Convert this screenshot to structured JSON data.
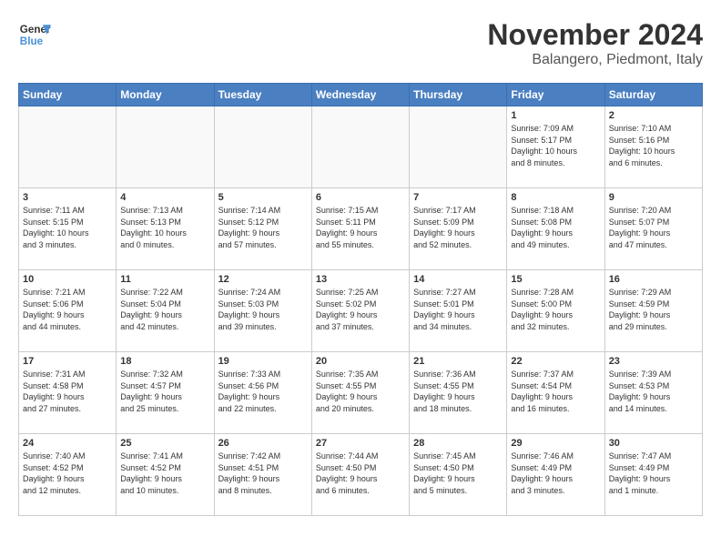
{
  "header": {
    "logo_line1": "General",
    "logo_line2": "Blue",
    "title": "November 2024",
    "subtitle": "Balangero, Piedmont, Italy"
  },
  "weekdays": [
    "Sunday",
    "Monday",
    "Tuesday",
    "Wednesday",
    "Thursday",
    "Friday",
    "Saturday"
  ],
  "weeks": [
    [
      {
        "day": "",
        "info": ""
      },
      {
        "day": "",
        "info": ""
      },
      {
        "day": "",
        "info": ""
      },
      {
        "day": "",
        "info": ""
      },
      {
        "day": "",
        "info": ""
      },
      {
        "day": "1",
        "info": "Sunrise: 7:09 AM\nSunset: 5:17 PM\nDaylight: 10 hours\nand 8 minutes."
      },
      {
        "day": "2",
        "info": "Sunrise: 7:10 AM\nSunset: 5:16 PM\nDaylight: 10 hours\nand 6 minutes."
      }
    ],
    [
      {
        "day": "3",
        "info": "Sunrise: 7:11 AM\nSunset: 5:15 PM\nDaylight: 10 hours\nand 3 minutes."
      },
      {
        "day": "4",
        "info": "Sunrise: 7:13 AM\nSunset: 5:13 PM\nDaylight: 10 hours\nand 0 minutes."
      },
      {
        "day": "5",
        "info": "Sunrise: 7:14 AM\nSunset: 5:12 PM\nDaylight: 9 hours\nand 57 minutes."
      },
      {
        "day": "6",
        "info": "Sunrise: 7:15 AM\nSunset: 5:11 PM\nDaylight: 9 hours\nand 55 minutes."
      },
      {
        "day": "7",
        "info": "Sunrise: 7:17 AM\nSunset: 5:09 PM\nDaylight: 9 hours\nand 52 minutes."
      },
      {
        "day": "8",
        "info": "Sunrise: 7:18 AM\nSunset: 5:08 PM\nDaylight: 9 hours\nand 49 minutes."
      },
      {
        "day": "9",
        "info": "Sunrise: 7:20 AM\nSunset: 5:07 PM\nDaylight: 9 hours\nand 47 minutes."
      }
    ],
    [
      {
        "day": "10",
        "info": "Sunrise: 7:21 AM\nSunset: 5:06 PM\nDaylight: 9 hours\nand 44 minutes."
      },
      {
        "day": "11",
        "info": "Sunrise: 7:22 AM\nSunset: 5:04 PM\nDaylight: 9 hours\nand 42 minutes."
      },
      {
        "day": "12",
        "info": "Sunrise: 7:24 AM\nSunset: 5:03 PM\nDaylight: 9 hours\nand 39 minutes."
      },
      {
        "day": "13",
        "info": "Sunrise: 7:25 AM\nSunset: 5:02 PM\nDaylight: 9 hours\nand 37 minutes."
      },
      {
        "day": "14",
        "info": "Sunrise: 7:27 AM\nSunset: 5:01 PM\nDaylight: 9 hours\nand 34 minutes."
      },
      {
        "day": "15",
        "info": "Sunrise: 7:28 AM\nSunset: 5:00 PM\nDaylight: 9 hours\nand 32 minutes."
      },
      {
        "day": "16",
        "info": "Sunrise: 7:29 AM\nSunset: 4:59 PM\nDaylight: 9 hours\nand 29 minutes."
      }
    ],
    [
      {
        "day": "17",
        "info": "Sunrise: 7:31 AM\nSunset: 4:58 PM\nDaylight: 9 hours\nand 27 minutes."
      },
      {
        "day": "18",
        "info": "Sunrise: 7:32 AM\nSunset: 4:57 PM\nDaylight: 9 hours\nand 25 minutes."
      },
      {
        "day": "19",
        "info": "Sunrise: 7:33 AM\nSunset: 4:56 PM\nDaylight: 9 hours\nand 22 minutes."
      },
      {
        "day": "20",
        "info": "Sunrise: 7:35 AM\nSunset: 4:55 PM\nDaylight: 9 hours\nand 20 minutes."
      },
      {
        "day": "21",
        "info": "Sunrise: 7:36 AM\nSunset: 4:55 PM\nDaylight: 9 hours\nand 18 minutes."
      },
      {
        "day": "22",
        "info": "Sunrise: 7:37 AM\nSunset: 4:54 PM\nDaylight: 9 hours\nand 16 minutes."
      },
      {
        "day": "23",
        "info": "Sunrise: 7:39 AM\nSunset: 4:53 PM\nDaylight: 9 hours\nand 14 minutes."
      }
    ],
    [
      {
        "day": "24",
        "info": "Sunrise: 7:40 AM\nSunset: 4:52 PM\nDaylight: 9 hours\nand 12 minutes."
      },
      {
        "day": "25",
        "info": "Sunrise: 7:41 AM\nSunset: 4:52 PM\nDaylight: 9 hours\nand 10 minutes."
      },
      {
        "day": "26",
        "info": "Sunrise: 7:42 AM\nSunset: 4:51 PM\nDaylight: 9 hours\nand 8 minutes."
      },
      {
        "day": "27",
        "info": "Sunrise: 7:44 AM\nSunset: 4:50 PM\nDaylight: 9 hours\nand 6 minutes."
      },
      {
        "day": "28",
        "info": "Sunrise: 7:45 AM\nSunset: 4:50 PM\nDaylight: 9 hours\nand 5 minutes."
      },
      {
        "day": "29",
        "info": "Sunrise: 7:46 AM\nSunset: 4:49 PM\nDaylight: 9 hours\nand 3 minutes."
      },
      {
        "day": "30",
        "info": "Sunrise: 7:47 AM\nSunset: 4:49 PM\nDaylight: 9 hours\nand 1 minute."
      }
    ]
  ]
}
